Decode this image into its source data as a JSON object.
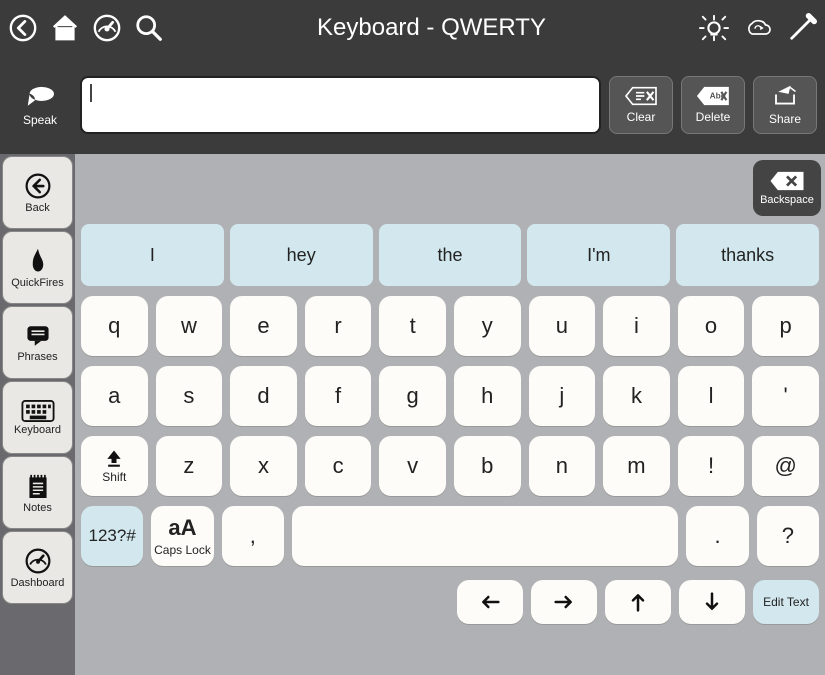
{
  "titlebar": {
    "title": "Keyboard - QWERTY"
  },
  "speakbar": {
    "speak_label": "Speak",
    "clear_label": "Clear",
    "delete_label": "Delete",
    "delete_icon_text": "Abc",
    "share_label": "Share"
  },
  "sidebar": {
    "back": "Back",
    "items": [
      {
        "label": "QuickFires"
      },
      {
        "label": "Phrases"
      },
      {
        "label": "Keyboard"
      },
      {
        "label": "Notes"
      },
      {
        "label": "Dashboard"
      }
    ]
  },
  "backspace": {
    "label": "Backspace"
  },
  "predictions": [
    "I",
    "hey",
    "the",
    "I'm",
    "thanks"
  ],
  "rows": {
    "r1": [
      "q",
      "w",
      "e",
      "r",
      "t",
      "y",
      "u",
      "i",
      "o",
      "p"
    ],
    "r2": [
      "a",
      "s",
      "d",
      "f",
      "g",
      "h",
      "j",
      "k",
      "l",
      "'"
    ],
    "r3_shift": "Shift",
    "r3": [
      "z",
      "x",
      "c",
      "v",
      "b",
      "n",
      "m",
      "!",
      "@"
    ],
    "r4_sym": "123?#",
    "r4_caps_big": "aA",
    "r4_caps_label": "Caps Lock",
    "r4_comma": ",",
    "r4_period": ".",
    "r4_question": "?",
    "edit_text": "Edit Text"
  }
}
